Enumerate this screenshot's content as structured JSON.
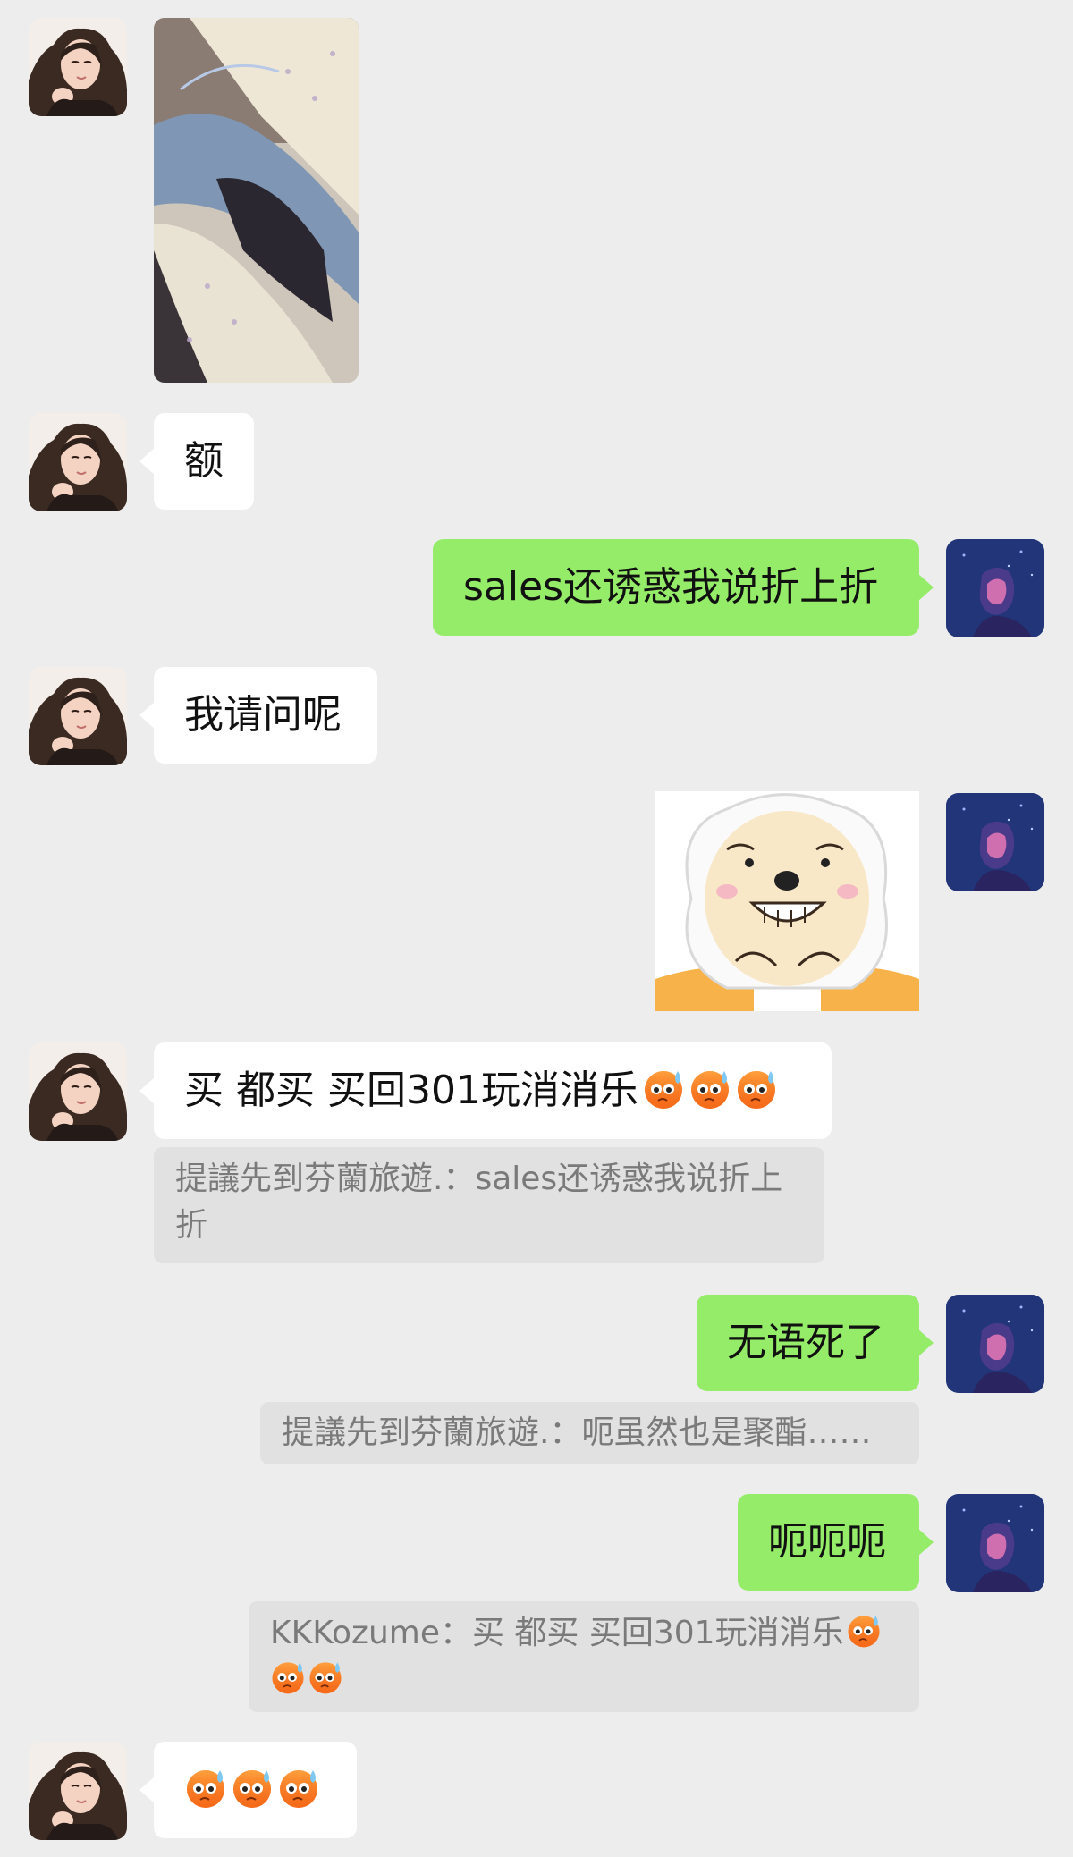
{
  "messages": {
    "m2": {
      "text": "额"
    },
    "m3": {
      "text": "sales还诱惑我说折上折"
    },
    "m4": {
      "text": "我请问呢"
    },
    "m6": {
      "text": "买 都买 买回301玩消消乐",
      "emoji": [
        "sweat-face",
        "sweat-face",
        "sweat-face"
      ],
      "quote": {
        "text": "提議先到芬蘭旅遊.：sales还诱惑我说折上折"
      }
    },
    "m7": {
      "text": "无语死了",
      "quote": {
        "text": "提議先到芬蘭旅遊.：呃虽然也是聚酯……"
      }
    },
    "m8": {
      "text": "呃呃呃",
      "quote": {
        "line1": "KKKozume：买 都买 买回301玩消消乐",
        "emoji": [
          "sweat-face",
          "sweat-face",
          "sweat-face"
        ]
      }
    },
    "m9": {
      "emoji": [
        "sweat-face",
        "sweat-face",
        "sweat-face"
      ]
    }
  },
  "colors": {
    "background": "#ededed",
    "bubble_left": "#ffffff",
    "bubble_right": "#95ec69",
    "quote_bg": "#e1e1e1",
    "quote_text": "#7a7a7a"
  }
}
